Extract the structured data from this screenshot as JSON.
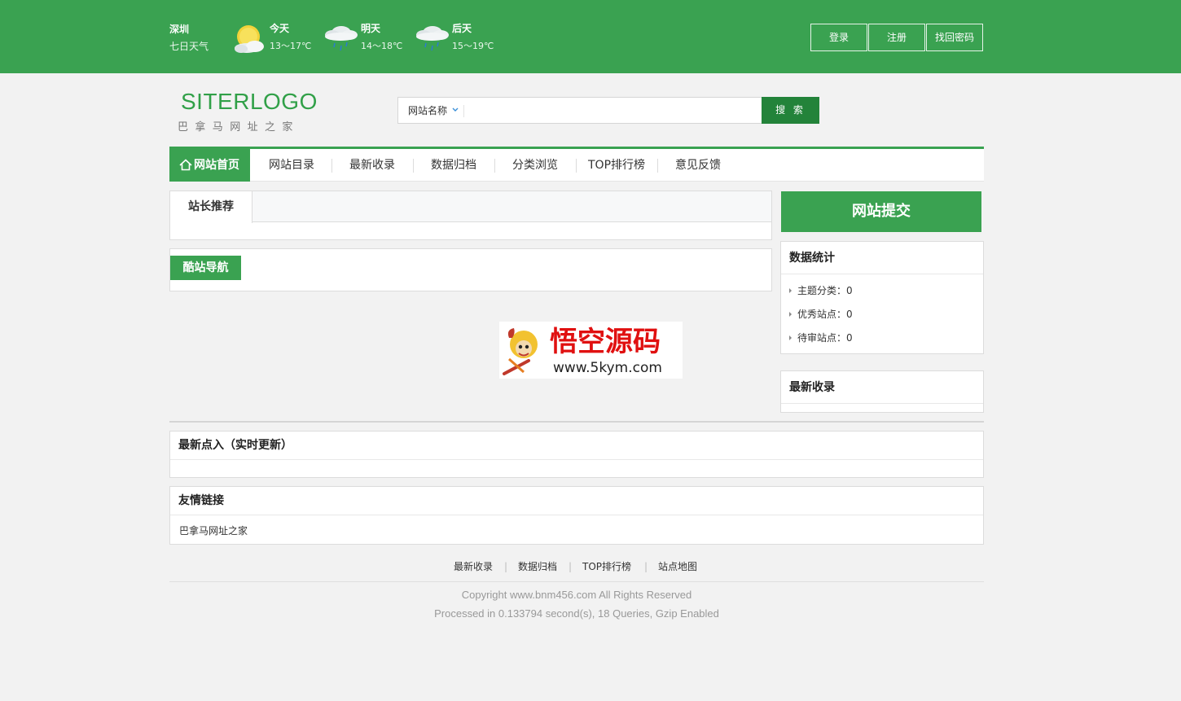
{
  "weather": {
    "city": "深圳",
    "subtitle": "七日天气",
    "days": [
      {
        "label": "今天",
        "temp": "13～17℃",
        "icon": "sun-cloud-icon"
      },
      {
        "label": "明天",
        "temp": "14～18℃",
        "icon": "rain-cloud-icon"
      },
      {
        "label": "后天",
        "temp": "15～19℃",
        "icon": "rain-cloud-icon"
      }
    ]
  },
  "auth": {
    "login": "登录",
    "register": "注册",
    "recover": "找回密码"
  },
  "logo": {
    "title": "SITERLOGO",
    "subtitle": "巴拿马网址之家"
  },
  "search": {
    "select_value": "网站名称",
    "button": "搜 索"
  },
  "nav": {
    "home": "网站首页",
    "items": [
      "网站目录",
      "最新收录",
      "数据归档",
      "分类浏览",
      "TOP排行榜",
      "意见反馈"
    ]
  },
  "main": {
    "recommend_tab": "站长推荐",
    "cool_nav": "酷站导航",
    "ad": {
      "title": "悟空源码",
      "url": "www.5kym.com"
    }
  },
  "sidebar": {
    "submit": "网站提交",
    "stats_title": "数据统计",
    "stats": [
      {
        "label": "主题分类：",
        "value": "0"
      },
      {
        "label": "优秀站点：",
        "value": "0"
      },
      {
        "label": "待审站点：",
        "value": "0"
      }
    ],
    "latest_title": "最新收录"
  },
  "recent_clicks_title": "最新点入（实时更新）",
  "friends": {
    "title": "友情链接",
    "links": [
      "巴拿马网址之家"
    ]
  },
  "footer": {
    "links": [
      "最新收录",
      "数据归档",
      "TOP排行榜",
      "站点地图"
    ],
    "separator": "|",
    "copyright": "Copyright www.bnm456.com All Rights Reserved",
    "processed": "Processed in 0.133794 second(s), 18 Queries, Gzip Enabled"
  },
  "colors": {
    "brand_green": "#3aa251",
    "button_dark_green": "#23833a",
    "background": "#f2f2f2"
  }
}
